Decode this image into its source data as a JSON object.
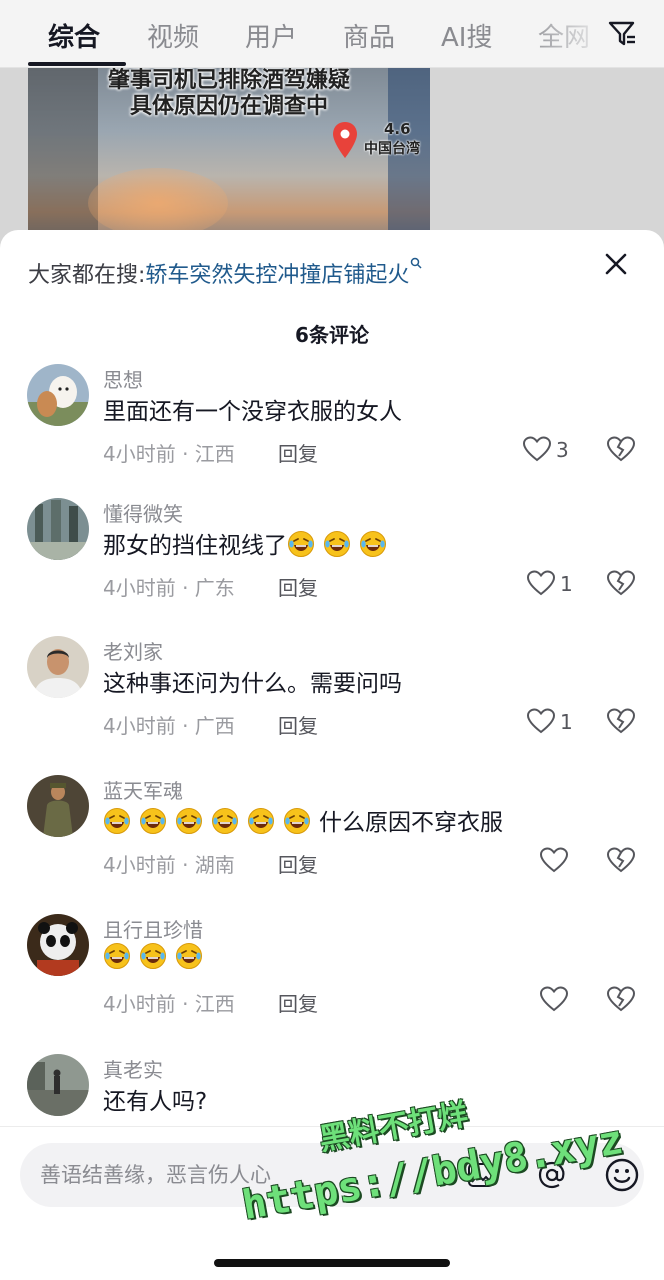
{
  "tabs": [
    {
      "label": "综合",
      "active": true
    },
    {
      "label": "视频",
      "active": false
    },
    {
      "label": "用户",
      "active": false
    },
    {
      "label": "商品",
      "active": false
    },
    {
      "label": "AI搜",
      "active": false
    },
    {
      "label": "全网",
      "active": false
    }
  ],
  "video": {
    "caption_line1": "肇事司机已排除酒驾嫌疑",
    "caption_line2": "具体原因仍在调查中",
    "pin_rating": "4.6",
    "pin_place": "中国台湾"
  },
  "sheet": {
    "trending_prefix": "大家都在搜:",
    "trending_topic": "轿车突然失控冲撞店铺起火",
    "comment_count": "6条评论"
  },
  "reply_label": "回复",
  "comments": [
    {
      "name": "思想",
      "text": "里面还有一个没穿衣服的女人",
      "emoji_count": 0,
      "meta": "4小时前 · 江西",
      "likes": "3"
    },
    {
      "name": "懂得微笑",
      "text": "那女的挡住视线了",
      "emoji_count": 3,
      "meta": "4小时前 · 广东",
      "likes": "1"
    },
    {
      "name": "老刘家",
      "text": "这种事还问为什么。需要问吗",
      "emoji_count": 0,
      "meta": "4小时前 · 广西",
      "likes": "1"
    },
    {
      "name": "蓝天军魂",
      "text": "什么原因不穿衣服",
      "emoji_count": 6,
      "meta": "4小时前 · 湖南",
      "likes": ""
    },
    {
      "name": "且行且珍惜",
      "text": "",
      "emoji_count": 3,
      "meta": "4小时前 · 江西",
      "likes": ""
    },
    {
      "name": "真老实",
      "text": "还有人吗?",
      "emoji_count": 0,
      "meta": "",
      "likes": ""
    }
  ],
  "input": {
    "placeholder": "善语结善缘，恶言伤人心"
  },
  "watermark": {
    "line1": "黑料不打烊",
    "line2": "https://bdy8.xyz"
  },
  "icons": [
    "filter-icon",
    "close-icon",
    "heart-icon",
    "broken-heart-icon",
    "image-icon",
    "at-icon",
    "smile-icon",
    "laughing-emoji-icon"
  ],
  "colors": {
    "topic_link": "#205a8c",
    "watermark": "#6ee07a"
  }
}
